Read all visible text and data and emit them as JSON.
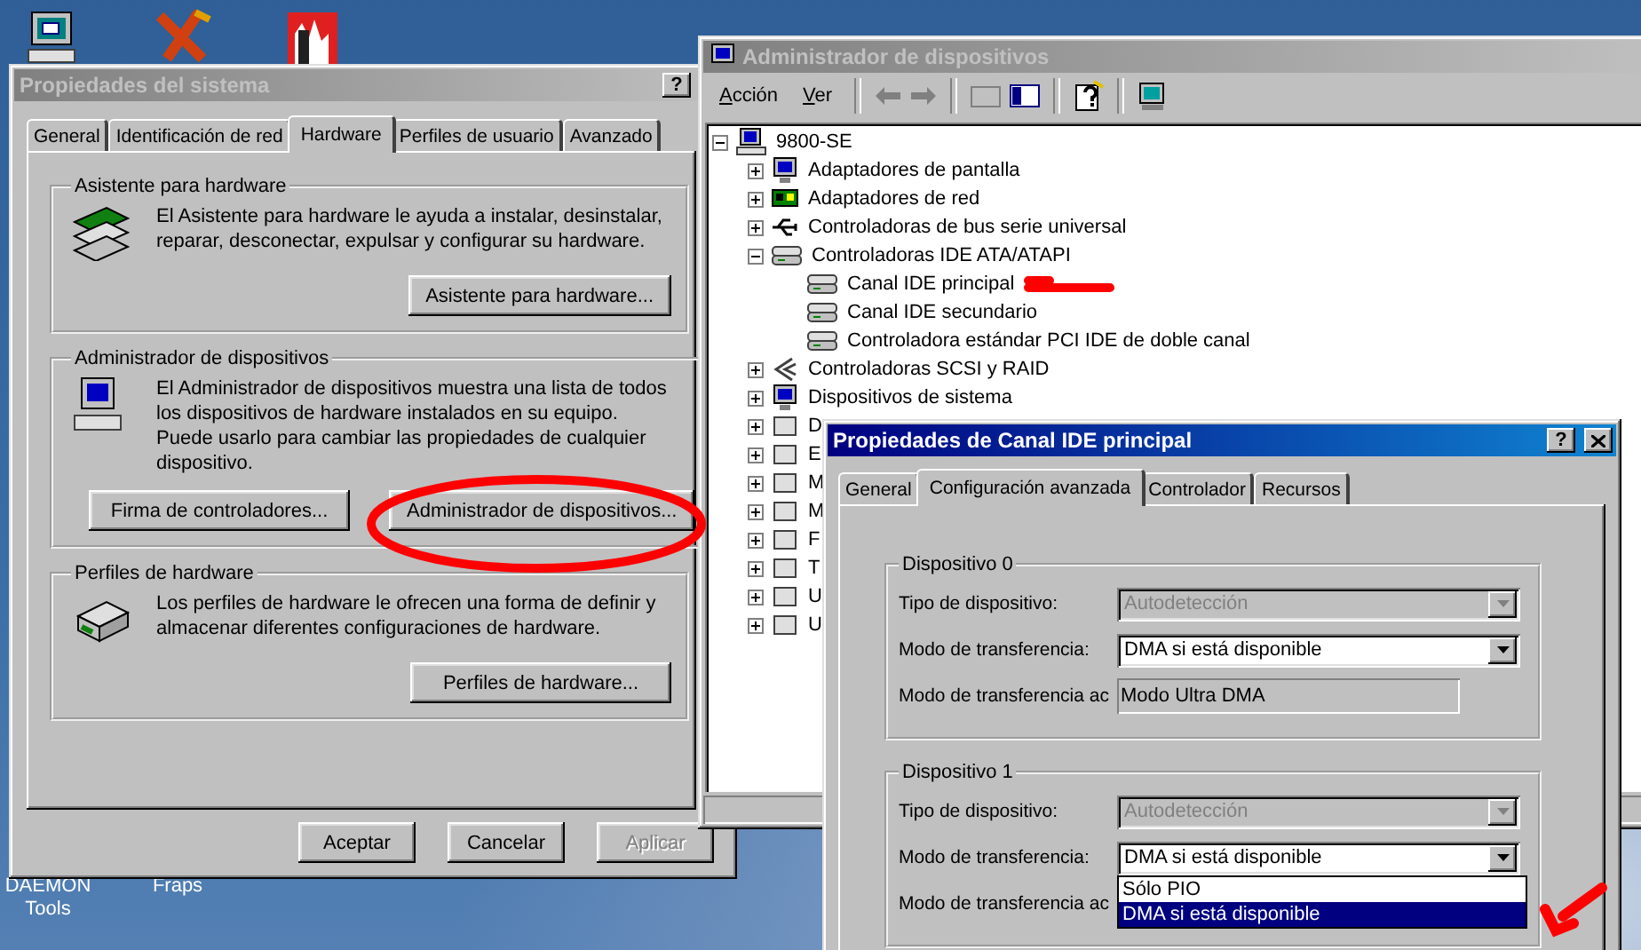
{
  "desktop": {
    "icon_labels": [
      "DAEMON Tools",
      "Fraps"
    ]
  },
  "system_properties": {
    "title": "Propiedades del sistema",
    "help_button": "?",
    "tabs": [
      {
        "label": "General",
        "selected": false
      },
      {
        "label": "Identificación de red",
        "selected": false
      },
      {
        "label": "Hardware",
        "selected": true
      },
      {
        "label": "Perfiles de usuario",
        "selected": false
      },
      {
        "label": "Avanzado",
        "selected": false
      }
    ],
    "groups": [
      {
        "title": "Asistente para hardware",
        "text": "El Asistente para hardware le ayuda a instalar, desinstalar, reparar, desconectar, expulsar y configurar su hardware.",
        "buttons": [
          "Asistente para hardware..."
        ]
      },
      {
        "title": "Administrador de dispositivos",
        "text": "El Administrador de dispositivos muestra una lista de todos los dispositivos de hardware instalados en su equipo. Puede usarlo para cambiar las propiedades de cualquier dispositivo.",
        "buttons": [
          "Firma de controladores...",
          "Administrador de dispositivos..."
        ]
      },
      {
        "title": "Perfiles de hardware",
        "text": "Los perfiles de hardware le ofrecen una forma de definir y almacenar diferentes configuraciones de hardware.",
        "buttons": [
          "Perfiles de hardware..."
        ]
      }
    ],
    "buttons": [
      {
        "label": "Aceptar",
        "disabled": false
      },
      {
        "label": "Cancelar",
        "disabled": false
      },
      {
        "label": "Aplicar",
        "disabled": true
      }
    ]
  },
  "device_manager": {
    "title": "Administrador de dispositivos",
    "menu": [
      "Acción",
      "Ver"
    ],
    "tree": {
      "label": "9800-SE",
      "expanded": true,
      "children": [
        {
          "label": "Adaptadores de pantalla",
          "expanded": false
        },
        {
          "label": "Adaptadores de red",
          "expanded": false
        },
        {
          "label": "Controladoras de bus serie universal",
          "expanded": false
        },
        {
          "label": "Controladoras IDE ATA/ATAPI",
          "expanded": true,
          "children": [
            {
              "label": "Canal IDE principal"
            },
            {
              "label": "Canal IDE secundario"
            },
            {
              "label": "Controladora estándar PCI IDE de doble canal"
            }
          ]
        },
        {
          "label": "Controladoras SCSI y RAID",
          "expanded": false
        },
        {
          "label": "Dispositivos de sistema",
          "expanded": false
        },
        {
          "label": "D",
          "expanded": false
        },
        {
          "label": "E",
          "expanded": false
        },
        {
          "label": "M",
          "expanded": false
        },
        {
          "label": "M",
          "expanded": false
        },
        {
          "label": "F",
          "expanded": false
        },
        {
          "label": "T",
          "expanded": false
        },
        {
          "label": "U",
          "expanded": false
        },
        {
          "label": "U",
          "expanded": false
        }
      ]
    }
  },
  "ide_properties": {
    "title": "Propiedades de Canal IDE principal",
    "help_button": "?",
    "tabs": [
      {
        "label": "General",
        "selected": false
      },
      {
        "label": "Configuración avanzada",
        "selected": true
      },
      {
        "label": "Controlador",
        "selected": false
      },
      {
        "label": "Recursos",
        "selected": false
      }
    ],
    "groups": [
      {
        "title": "Dispositivo 0",
        "rows": [
          {
            "kind": "combo",
            "label": "Tipo de dispositivo:",
            "value": "Autodetección",
            "disabled": true
          },
          {
            "kind": "combo",
            "label": "Modo de transferencia:",
            "value": "DMA si está disponible",
            "disabled": false
          },
          {
            "kind": "readonly",
            "label": "Modo de transferencia ac",
            "value": "Modo Ultra DMA"
          }
        ]
      },
      {
        "title": "Dispositivo 1",
        "rows": [
          {
            "kind": "combo",
            "label": "Tipo de dispositivo:",
            "value": "Autodetección",
            "disabled": true
          },
          {
            "kind": "combo",
            "label": "Modo de transferencia:",
            "value": "DMA si está disponible",
            "disabled": false,
            "options": [
              {
                "label": "Sólo PIO",
                "selected": false
              },
              {
                "label": "DMA si está disponible",
                "selected": true
              }
            ]
          },
          {
            "kind": "readonly",
            "label": "Modo de transferencia ac"
          }
        ]
      }
    ]
  }
}
